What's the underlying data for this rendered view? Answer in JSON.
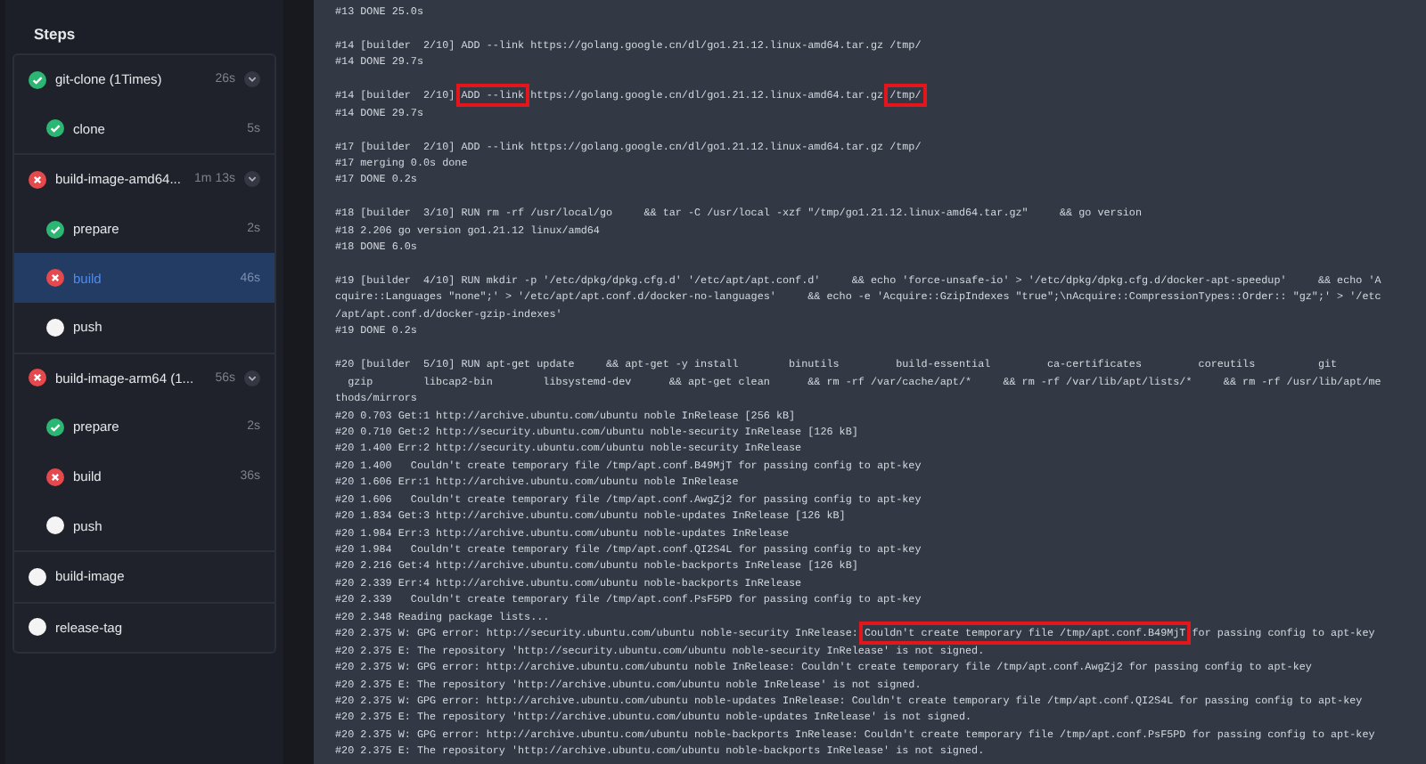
{
  "sidebar": {
    "title": "Steps",
    "groups": [
      {
        "label": "git-clone (1Times)",
        "kind": "success",
        "duration": "26s",
        "expanded": true,
        "selected": false,
        "children": [
          {
            "label": "clone",
            "kind": "success",
            "duration": "5s",
            "selected": false
          }
        ]
      },
      {
        "label": "build-image-amd64...",
        "kind": "failure",
        "duration": "1m 13s",
        "expanded": true,
        "selected": false,
        "children": [
          {
            "label": "prepare",
            "kind": "success",
            "duration": "2s",
            "selected": false
          },
          {
            "label": "build",
            "kind": "failure",
            "duration": "46s",
            "selected": true
          },
          {
            "label": "push",
            "kind": "pending",
            "selected": false
          }
        ]
      },
      {
        "label": "build-image-arm64 (1...",
        "kind": "failure",
        "duration": "56s",
        "expanded": true,
        "selected": false,
        "children": [
          {
            "label": "prepare",
            "kind": "success",
            "duration": "2s",
            "selected": false
          },
          {
            "label": "build",
            "kind": "failure",
            "duration": "36s",
            "selected": false
          },
          {
            "label": "push",
            "kind": "pending",
            "selected": false
          }
        ]
      },
      {
        "label": "build-image",
        "kind": "pending",
        "selected": false
      },
      {
        "label": "release-tag",
        "kind": "pending",
        "selected": false
      }
    ]
  },
  "log": {
    "blocks": [
      [
        "#13 DONE 25.0s"
      ],
      [
        "#14 [builder  2/10] ADD --link https://golang.google.cn/dl/go1.21.12.linux-amd64.tar.gz /tmp/",
        "#14 DONE 29.7s"
      ],
      [
        {
          "segments": [
            {
              "text": "#14 [builder  2/10] ",
              "highlighted": false
            },
            {
              "text": "ADD --link",
              "highlighted": true
            },
            {
              "text": " https://golang.google.cn/dl/go1.21.12.linux-amd64.tar.gz ",
              "highlighted": false
            },
            {
              "text": "/tmp/",
              "highlighted": true
            }
          ]
        },
        "#14 DONE 29.7s"
      ],
      [
        "#17 [builder  2/10] ADD --link https://golang.google.cn/dl/go1.21.12.linux-amd64.tar.gz /tmp/",
        "#17 merging 0.0s done",
        "#17 DONE 0.2s"
      ],
      [
        "#18 [builder  3/10] RUN rm -rf /usr/local/go     && tar -C /usr/local -xzf \"/tmp/go1.21.12.linux-amd64.tar.gz\"     && go version",
        "#18 2.206 go version go1.21.12 linux/amd64",
        "#18 DONE 6.0s"
      ],
      [
        "#19 [builder  4/10] RUN mkdir -p '/etc/dpkg/dpkg.cfg.d' '/etc/apt/apt.conf.d'     && echo 'force-unsafe-io' > '/etc/dpkg/dpkg.cfg.d/docker-apt-speedup'     && echo 'A",
        "cquire::Languages \"none\";' > '/etc/apt/apt.conf.d/docker-no-languages'     && echo -e 'Acquire::GzipIndexes \"true\";\\nAcquire::CompressionTypes::Order:: \"gz\";' > '/etc",
        "/apt/apt.conf.d/docker-gzip-indexes'",
        "#19 DONE 0.2s"
      ],
      [
        "#20 [builder  5/10] RUN apt-get update     && apt-get -y install        binutils         build-essential         ca-certificates         coreutils          git",
        "  gzip        libcap2-bin        libsystemd-dev      && apt-get clean      && rm -rf /var/cache/apt/*     && rm -rf /var/lib/apt/lists/*     && rm -rf /usr/lib/apt/me",
        "thods/mirrors",
        "#20 0.703 Get:1 http://archive.ubuntu.com/ubuntu noble InRelease [256 kB]",
        "#20 0.710 Get:2 http://security.ubuntu.com/ubuntu noble-security InRelease [126 kB]",
        "#20 1.400 Err:2 http://security.ubuntu.com/ubuntu noble-security InRelease",
        "#20 1.400   Couldn't create temporary file /tmp/apt.conf.B49MjT for passing config to apt-key",
        "#20 1.606 Err:1 http://archive.ubuntu.com/ubuntu noble InRelease",
        "#20 1.606   Couldn't create temporary file /tmp/apt.conf.AwgZj2 for passing config to apt-key",
        "#20 1.834 Get:3 http://archive.ubuntu.com/ubuntu noble-updates InRelease [126 kB]",
        "#20 1.984 Err:3 http://archive.ubuntu.com/ubuntu noble-updates InRelease",
        "#20 1.984   Couldn't create temporary file /tmp/apt.conf.QI2S4L for passing config to apt-key",
        "#20 2.216 Get:4 http://archive.ubuntu.com/ubuntu noble-backports InRelease [126 kB]",
        "#20 2.339 Err:4 http://archive.ubuntu.com/ubuntu noble-backports InRelease",
        "#20 2.339   Couldn't create temporary file /tmp/apt.conf.PsF5PD for passing config to apt-key",
        "#20 2.348 Reading package lists...",
        {
          "segments": [
            {
              "text": "#20 2.375 W: GPG error: http://security.ubuntu.com/ubuntu noble-security InRelease: ",
              "highlighted": false
            },
            {
              "text": "Couldn't create temporary file /tmp/apt.conf.B49MjT",
              "highlighted": true
            },
            {
              "text": " for passing config to apt-key",
              "highlighted": false
            }
          ]
        },
        "#20 2.375 E: The repository 'http://security.ubuntu.com/ubuntu noble-security InRelease' is not signed.",
        "#20 2.375 W: GPG error: http://archive.ubuntu.com/ubuntu noble InRelease: Couldn't create temporary file /tmp/apt.conf.AwgZj2 for passing config to apt-key",
        "#20 2.375 E: The repository 'http://archive.ubuntu.com/ubuntu noble InRelease' is not signed.",
        "#20 2.375 W: GPG error: http://archive.ubuntu.com/ubuntu noble-updates InRelease: Couldn't create temporary file /tmp/apt.conf.QI2S4L for passing config to apt-key",
        "#20 2.375 E: The repository 'http://archive.ubuntu.com/ubuntu noble-updates InRelease' is not signed.",
        "#20 2.375 W: GPG error: http://archive.ubuntu.com/ubuntu noble-backports InRelease: Couldn't create temporary file /tmp/apt.conf.PsF5PD for passing config to apt-key",
        "#20 2.375 E: The repository 'http://archive.ubuntu.com/ubuntu noble-backports InRelease' is not signed."
      ]
    ]
  }
}
